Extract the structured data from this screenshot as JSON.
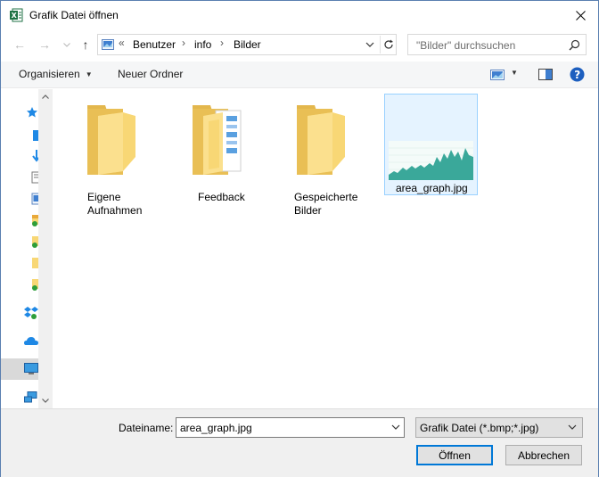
{
  "window": {
    "title": "Grafik Datei öffnen",
    "app_icon": "excel-icon",
    "close_glyph": "✕"
  },
  "navigation": {
    "back_glyph": "←",
    "forward_glyph": "→",
    "recent_glyph": "⌄",
    "up_glyph": "↑"
  },
  "address": {
    "overflow": "«",
    "crumbs": [
      "Benutzer",
      "info",
      "Bilder"
    ],
    "separator": "›"
  },
  "search": {
    "placeholder": "\"Bilder\" durchsuchen"
  },
  "toolbar": {
    "organize_label": "Organisieren",
    "new_folder_label": "Neuer Ordner"
  },
  "files": [
    {
      "name_line1": "Eigene",
      "name_line2": "Aufnahmen",
      "type": "folder"
    },
    {
      "name_line1": "Feedback",
      "name_line2": "",
      "type": "folder-with-docs"
    },
    {
      "name_line1": "Gespeicherte",
      "name_line2": "Bilder",
      "type": "folder"
    },
    {
      "name_line1": "area_graph.jpg",
      "name_line2": "",
      "type": "image",
      "selected": true
    }
  ],
  "bottom": {
    "filename_label": "Dateiname:",
    "filename_value": "area_graph.jpg",
    "filetype_value": "Grafik Datei (*.bmp;*.jpg)",
    "open_label": "Öffnen",
    "cancel_label": "Abbrechen"
  },
  "colors": {
    "accent": "#0078d7",
    "folder": "#f8d775",
    "graph_fill": "#3aa89a",
    "excel_green": "#1f7244"
  }
}
